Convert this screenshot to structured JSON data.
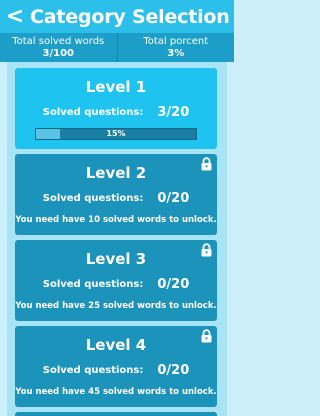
{
  "header": {
    "back_label": "<",
    "title": "Category Selection"
  },
  "stats": {
    "total_solved_label": "Total solved words",
    "total_solved_value": "3/100",
    "total_percent_label": "Total porcent",
    "total_percent_value": "3%"
  },
  "levels": [
    {
      "title": "Level 1",
      "solved_label": "Solved questions:",
      "solved_value": "3/20",
      "locked": false,
      "progress_fraction": 0.15,
      "progress_label": "15%"
    },
    {
      "title": "Level 2",
      "solved_label": "Solved questions:",
      "solved_value": "0/20",
      "locked": true,
      "unlock_message": "You need have 10 solved words to unlock."
    },
    {
      "title": "Level 3",
      "solved_label": "Solved questions:",
      "solved_value": "0/20",
      "locked": true,
      "unlock_message": "You need have 25 solved words to unlock."
    },
    {
      "title": "Level 4",
      "solved_label": "Solved questions:",
      "solved_value": "0/20",
      "locked": true,
      "unlock_message": "You need have 45 solved words to unlock."
    }
  ],
  "icons": {
    "lock": "lock-icon"
  },
  "colors": {
    "header": "#2bbfe9",
    "stats_bar": "#1d9ec8",
    "unlocked_card": "#1ec3f0",
    "locked_card": "#1b93bb"
  }
}
